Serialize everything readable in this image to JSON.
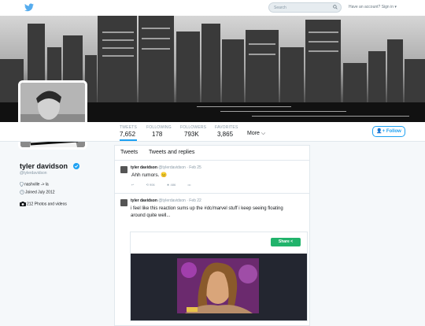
{
  "topbar": {
    "search_placeholder": "Search",
    "signin_text": "Have an account? Sign in ▾"
  },
  "nav": {
    "tweets_label": "TWEETS",
    "tweets_count": "7,652",
    "following_label": "FOLLOWING",
    "following_count": "178",
    "followers_label": "FOLLOWERS",
    "followers_count": "793K",
    "favorites_label": "FAVORITES",
    "favorites_count": "3,865",
    "more_label": "More ⌵",
    "follow_label": "Follow"
  },
  "profile": {
    "name": "tyler davidson",
    "handle": "@tylerdavidson",
    "location": "nashville -> la",
    "joined": "Joined July 2012",
    "photos": "212 Photos and videos"
  },
  "timeline": {
    "tabs": [
      "Tweets",
      "Tweets and replies"
    ],
    "tweets": [
      {
        "name": "tyler davidson",
        "handle": "@tylerdavidson · Feb 25",
        "text": "Ahh rumors. 😐",
        "retweets": "906",
        "favorites": "486"
      },
      {
        "name": "tyler davidson",
        "handle": "@tylerdavidson · Feb 22",
        "text_line1": "i feel like this reaction sums up the #dc/marvel stuff i keep seeing floating",
        "text_line2": "around quite well...",
        "share_label": "Share"
      }
    ]
  },
  "colors": {
    "accent": "#1da1f2",
    "share_green": "#21b36b"
  }
}
